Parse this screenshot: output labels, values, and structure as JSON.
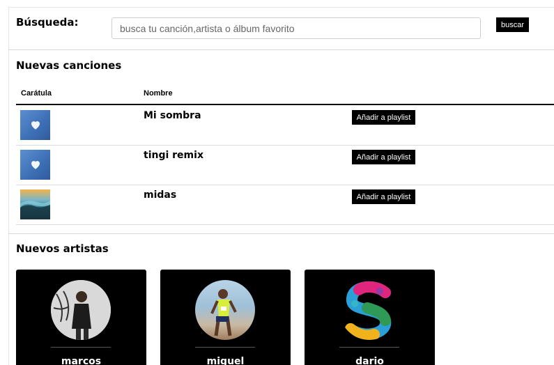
{
  "search": {
    "label": "Búsqueda:",
    "placeholder": "busca tu canción,artista o álbum favorito",
    "button_label": "buscar"
  },
  "new_songs": {
    "title": "Nuevas canciones",
    "columns": [
      "Carátula",
      "Nombre"
    ],
    "rows": [
      {
        "name": "Mi sombra",
        "cover_icon": "heart-cover",
        "action_label": "Añadir a playlist"
      },
      {
        "name": "tingi remix",
        "cover_icon": "heart-cover",
        "action_label": "Añadir a playlist"
      },
      {
        "name": "midas",
        "cover_icon": "beach-cover",
        "action_label": "Añadir a playlist"
      }
    ]
  },
  "new_artists": {
    "title": "Nuevos artistas",
    "cards": [
      {
        "name": "marcos",
        "avatar_icon": "person-photo"
      },
      {
        "name": "miguel",
        "avatar_icon": "athlete-photo"
      },
      {
        "name": "dario",
        "avatar_icon": "s-logo"
      }
    ]
  },
  "colors": {
    "button_bg": "#000000",
    "button_text": "#ffffff",
    "card_bg": "#000000"
  }
}
